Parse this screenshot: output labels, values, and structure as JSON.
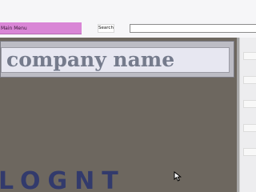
{
  "nav": {
    "main_menu_label": "Main Menu",
    "search_button_label": "Search",
    "search_value": ""
  },
  "banner": {
    "company_name": "company name"
  },
  "canvas": {
    "bottom_text": "LOGNT"
  },
  "icons": {
    "cursor": "mouse-pointer-icon"
  },
  "colors": {
    "menu_bg": "#d986d6",
    "canvas_bg": "#6d675f",
    "banner_text": "#757b8c",
    "bottom_text": "#323a6c"
  }
}
